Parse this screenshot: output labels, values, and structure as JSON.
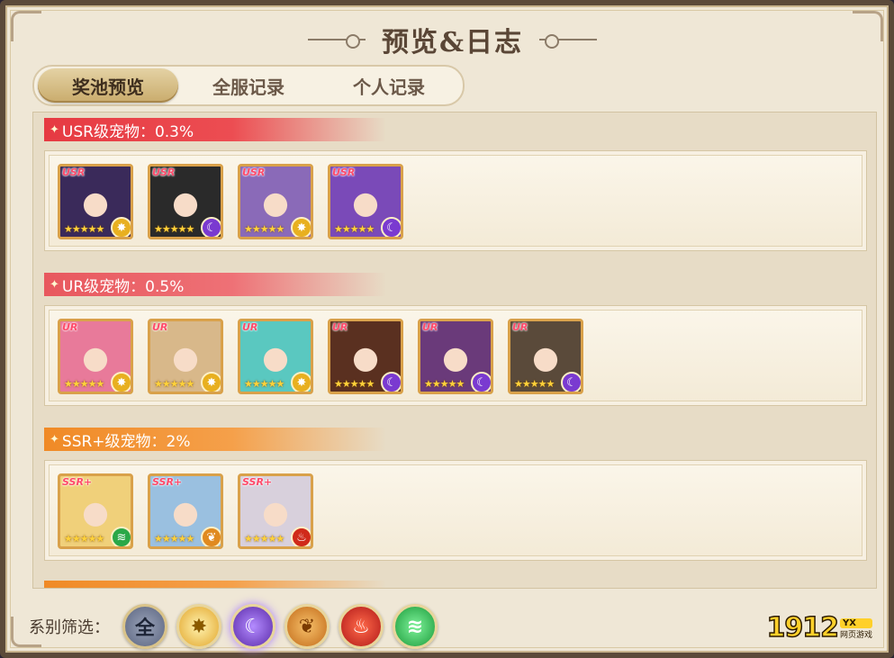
{
  "title": "预览&日志",
  "tabs": [
    {
      "label": "奖池预览",
      "active": true
    },
    {
      "label": "全服记录",
      "active": false
    },
    {
      "label": "个人记录",
      "active": false
    }
  ],
  "sections": [
    {
      "label": "USR级宠物：0.3%",
      "pets": [
        {
          "rarity": "USR",
          "stars": "★★★★★",
          "element": "light",
          "color": "#3a2a5a"
        },
        {
          "rarity": "USR",
          "stars": "★★★★★",
          "element": "dark",
          "color": "#2a2a2a"
        },
        {
          "rarity": "USR",
          "stars": "★★★★★",
          "element": "light",
          "color": "#8a6ab8"
        },
        {
          "rarity": "USR",
          "stars": "★★★★★",
          "element": "dark",
          "color": "#7a4ab8"
        }
      ]
    },
    {
      "label": "UR级宠物：0.5%",
      "pets": [
        {
          "rarity": "UR",
          "stars": "★★★★★",
          "element": "light",
          "color": "#e87a9a"
        },
        {
          "rarity": "UR",
          "stars": "★★★★★",
          "element": "light",
          "color": "#d8b88a"
        },
        {
          "rarity": "UR",
          "stars": "★★★★★",
          "element": "light",
          "color": "#5ac8c0"
        },
        {
          "rarity": "UR",
          "stars": "★★★★★",
          "element": "dark",
          "color": "#5a3020"
        },
        {
          "rarity": "UR",
          "stars": "★★★★★",
          "element": "dark",
          "color": "#6a3a7a"
        },
        {
          "rarity": "UR",
          "stars": "★★★★★",
          "element": "dark",
          "color": "#5a4a3a"
        }
      ]
    },
    {
      "label": "SSR+级宠物：2%",
      "pets": [
        {
          "rarity": "SSR+",
          "stars": "★★★★★",
          "element": "wind",
          "color": "#f0d07a"
        },
        {
          "rarity": "SSR+",
          "stars": "★★★★★",
          "element": "earth",
          "color": "#9ac0e0"
        },
        {
          "rarity": "SSR+",
          "stars": "★★★★★",
          "element": "fire",
          "color": "#d8d0dc"
        }
      ]
    }
  ],
  "filter": {
    "label": "系别筛选：",
    "options": [
      {
        "name": "all",
        "glyph": "全"
      },
      {
        "name": "light",
        "glyph": "✸"
      },
      {
        "name": "dark",
        "glyph": "☾"
      },
      {
        "name": "earth",
        "glyph": "❦"
      },
      {
        "name": "fire",
        "glyph": "♨"
      },
      {
        "name": "wind",
        "glyph": "≋"
      }
    ]
  },
  "logo": {
    "number": "1912",
    "badge": "YX",
    "sub": "网页游戏"
  },
  "elements": {
    "light": {
      "bg": "#e8b020",
      "glyph": "✸"
    },
    "dark": {
      "bg": "#7a3ad0",
      "glyph": "☾"
    },
    "wind": {
      "bg": "#2aa848",
      "glyph": "≋"
    },
    "earth": {
      "bg": "#e08a20",
      "glyph": "❦"
    },
    "fire": {
      "bg": "#d02a1a",
      "glyph": "♨"
    }
  }
}
